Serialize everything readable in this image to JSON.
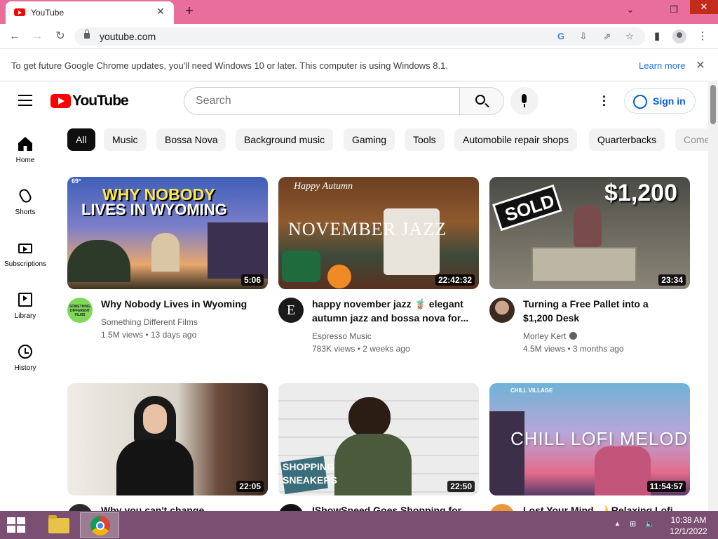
{
  "browser": {
    "tab_title": "YouTube",
    "tab_close": "✕",
    "new_tab": "+",
    "url": "youtube.com",
    "window_controls": {
      "minimize": "⌄",
      "restore": "❐",
      "close": "✕"
    },
    "nav": {
      "back": "←",
      "forward": "→",
      "reload": "↻"
    },
    "toolbar_icons": {
      "google": "G",
      "install": "⇩",
      "share": "⇗",
      "bookmark": "☆",
      "side_panel": "▮",
      "menu": "⋮"
    }
  },
  "infobar": {
    "message": "To get future Google Chrome updates, you'll need Windows 10 or later. This computer is using Windows 8.1.",
    "learn_more": "Learn more",
    "close": "✕"
  },
  "youtube": {
    "logo_text": "YouTube",
    "search_placeholder": "Search",
    "sign_in": "Sign in",
    "more": "⋮",
    "guide": [
      {
        "label": "Home",
        "icon": "home-icon"
      },
      {
        "label": "Shorts",
        "icon": "shorts-icon"
      },
      {
        "label": "Subscriptions",
        "icon": "subscriptions-icon"
      },
      {
        "label": "Library",
        "icon": "library-icon"
      },
      {
        "label": "History",
        "icon": "history-icon"
      }
    ],
    "chips": [
      "All",
      "Music",
      "Bossa Nova",
      "Background music",
      "Gaming",
      "Tools",
      "Automobile repair shops",
      "Quarterbacks",
      "Comedy"
    ],
    "videos": [
      {
        "title_line1": "Why Nobody Lives in Wyoming",
        "title_line2": "",
        "channel": "Something Different Films",
        "verified": false,
        "meta": "1.5M views • 13 days ago",
        "duration": "5:06",
        "overlay_line1": "WHY NOBODY",
        "overlay_line2": "LIVES IN WYOMING",
        "overlay_corner": "69°",
        "avatar_text": "SOMETHING DIFFERENT FILMS"
      },
      {
        "title_line1": "happy november jazz 🧋 elegant",
        "title_line2": "autumn jazz and bossa nova for...",
        "channel": "Espresso Music",
        "verified": false,
        "meta": "783K views • 2 weeks ago",
        "duration": "22:42:32",
        "overlay_line1": "Happy Autumn",
        "overlay_line2": "NOVEMBER JAZZ",
        "avatar_text": "E"
      },
      {
        "title_line1": "Turning a Free Pallet into a",
        "title_line2": "$1,200 Desk",
        "channel": "Morley Kert",
        "verified": true,
        "meta": "4.5M views • 3 months ago",
        "duration": "23:34",
        "overlay_line1": "SOLD",
        "overlay_line2": "$1,200"
      },
      {
        "title_line1": "Why you can't change",
        "channel": "",
        "meta": "",
        "duration": "22:05"
      },
      {
        "title_line1": "IShowSpeed Goes Shopping for...",
        "channel": "",
        "meta": "",
        "duration": "22:50",
        "overlay_line1": "SHOPPING",
        "overlay_line2": "SNEAKERS"
      },
      {
        "title_line1": "Lost Your Mind 🌙 Relaxing Lofi",
        "channel": "",
        "meta": "",
        "duration": "11:54:57",
        "overlay_line1": "CHILL VILLAGE",
        "overlay_line2": "CHILL LOFI MELODY"
      }
    ]
  },
  "taskbar": {
    "time": "10:38 AM",
    "date": "12/1/2022",
    "tray_icons": {
      "arrow": "▲",
      "network": "⊞",
      "volume": "🔈"
    }
  }
}
